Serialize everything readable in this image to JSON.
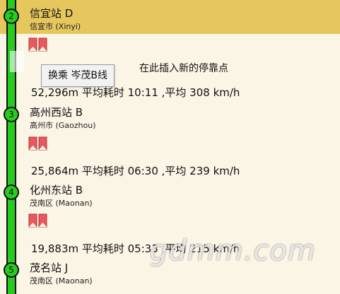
{
  "colors": {
    "line": "#26cc1e",
    "highlight": "#e6c75e",
    "background": "#fbf5e6",
    "bookmark": "#e8585d"
  },
  "stops": [
    {
      "number": "2",
      "name": "信宜站 D",
      "city": "信宜市 (Xinyi)"
    },
    {
      "number": "3",
      "name": "高州西站 B",
      "city": "高州市 (Gaozhou)"
    },
    {
      "number": "4",
      "name": "化州东站 B",
      "city": "茂南区 (Maonan)"
    },
    {
      "number": "5",
      "name": "茂名站 J",
      "city": "茂南区 (Maonan)"
    }
  ],
  "segments": [
    "52,296m 平均耗时 10:11 ,平均 308 km/h",
    "25,864m 平均耗时 06:30 ,平均 239 km/h",
    "19,883m 平均耗时 05:33 ,平均 215 km/h"
  ],
  "insert_hint": "在此插入新的停靠点",
  "tooltip": "换乘 岑茂B线",
  "watermark": "gdmm.com",
  "icons": [
    "bookmark-icon"
  ]
}
